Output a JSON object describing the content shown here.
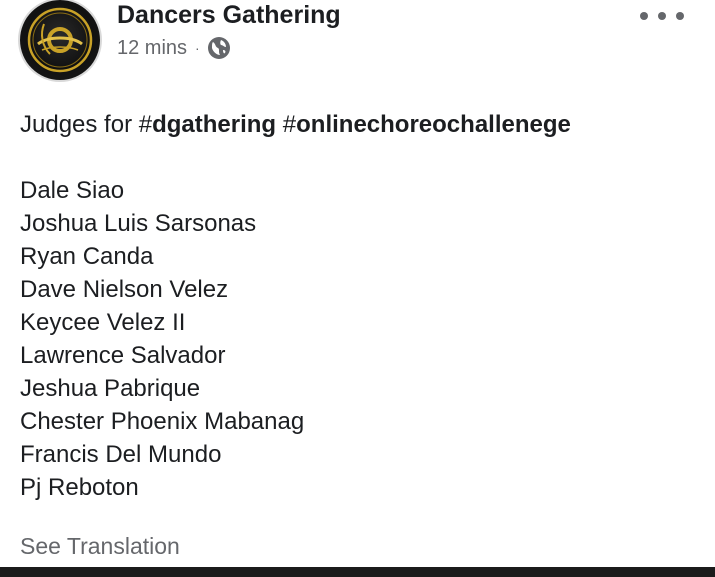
{
  "post": {
    "author": "Dancers Gathering",
    "timestamp": "12 mins",
    "separator": "·",
    "privacy_icon": "globe-icon",
    "more_icon": "more-options-icon",
    "avatar_logo_text": "Dgathering",
    "headline": {
      "prefix": "Judges for ",
      "hash1": "#",
      "tag1": "dgathering",
      "space": " ",
      "hash2": "#",
      "tag2": "onlinechoreochallenege"
    },
    "judges": [
      "Dale Siao",
      "Joshua Luis Sarsonas",
      "Ryan Canda",
      "Dave Nielson Velez",
      "Keycee Velez II",
      "Lawrence Salvador",
      "Jeshua Pabrique",
      "Chester Phoenix Mabanag",
      "Francis Del Mundo",
      "Pj Reboton"
    ],
    "see_translation": "See Translation"
  },
  "colors": {
    "text": "#1c1e21",
    "secondary_text": "#65676b",
    "avatar_bg": "#111111",
    "logo_gold": "#c9a227",
    "bottom_bar": "#1b1b1b"
  }
}
